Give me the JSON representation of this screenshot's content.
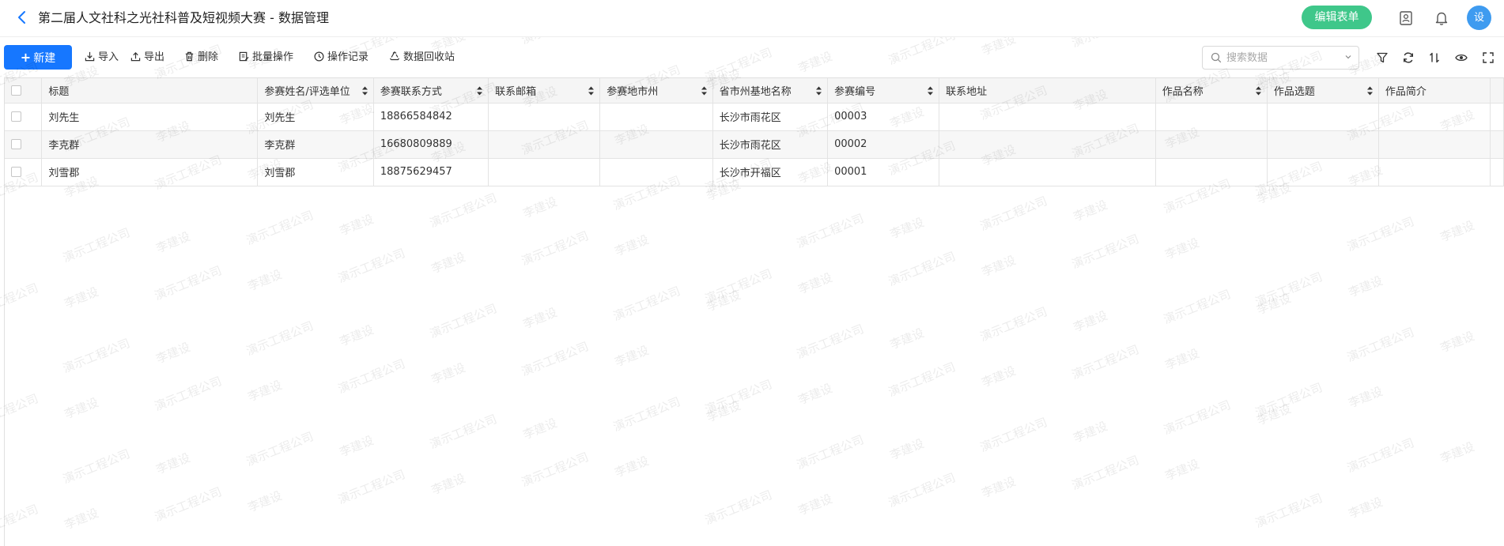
{
  "header": {
    "title": "第二届人文社科之光社科普及短视频大赛 - 数据管理",
    "edit_form_label": "编辑表单",
    "avatar_text": "设"
  },
  "toolbar": {
    "new_label": "新建",
    "import_label": "导入",
    "export_label": "导出",
    "delete_label": "删除",
    "batch_label": "批量操作",
    "log_label": "操作记录",
    "recycle_label": "数据回收站",
    "search_placeholder": "搜索数据"
  },
  "table": {
    "columns": [
      {
        "label": "标题",
        "sortable": false
      },
      {
        "label": "参赛姓名/评选单位",
        "sortable": true
      },
      {
        "label": "参赛联系方式",
        "sortable": true
      },
      {
        "label": "联系邮箱",
        "sortable": true
      },
      {
        "label": "参赛地市州",
        "sortable": true
      },
      {
        "label": "省市州基地名称",
        "sortable": true
      },
      {
        "label": "参赛编号",
        "sortable": true
      },
      {
        "label": "联系地址",
        "sortable": false
      },
      {
        "label": "作品名称",
        "sortable": true
      },
      {
        "label": "作品选题",
        "sortable": true
      },
      {
        "label": "作品简介",
        "sortable": false
      }
    ],
    "rows": [
      [
        "刘先生",
        "刘先生",
        "18866584842",
        "",
        "",
        "长沙市雨花区",
        "00003",
        "",
        "",
        "",
        ""
      ],
      [
        "李克群",
        "李克群",
        "16680809889",
        "",
        "",
        "长沙市雨花区",
        "00002",
        "",
        "",
        "",
        ""
      ],
      [
        "刘雪郡",
        "刘雪郡",
        "18875629457",
        "",
        "",
        "长沙市开福区",
        "00001",
        "",
        "",
        "",
        ""
      ]
    ]
  },
  "watermark": {
    "company": "演示工程公司",
    "user": "李建设"
  },
  "colors": {
    "primary": "#1677ff",
    "edit_button": "#3fc78a",
    "avatar": "#3e9bf0"
  }
}
